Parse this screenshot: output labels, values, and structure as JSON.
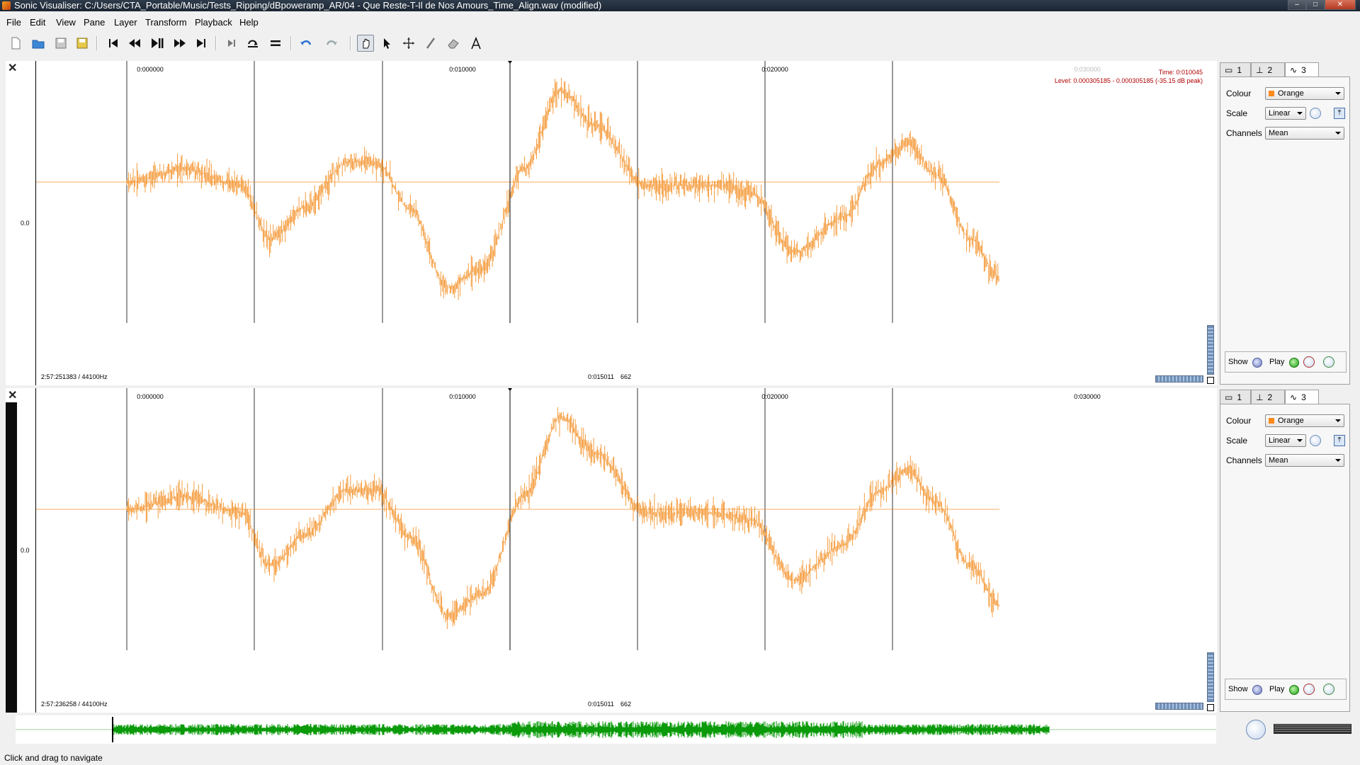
{
  "window": {
    "title": "Sonic Visualiser: C:/Users/CTA_Portable/Music/Tests_Ripping/dBpoweramp_AR/04 - Que Reste-T-Il de Nos Amours_Time_Align.wav (modified)",
    "minimize": "–",
    "maximize": "□",
    "close": "✕"
  },
  "menu": [
    "File",
    "Edit",
    "View",
    "Pane",
    "Layer",
    "Transform",
    "Playback",
    "Help"
  ],
  "toolbar": {
    "icons": [
      "new-document-icon",
      "open-folder-icon",
      "save-icon",
      "save-session-icon",
      "rewind-start-icon",
      "rewind-icon",
      "play-pause-icon",
      "fast-forward-icon",
      "fast-forward-end-icon",
      "constrain-playback-icon",
      "follow-playback-icon",
      "loop-icon",
      "undo-icon",
      "redo-icon",
      "navigate-icon",
      "select-icon",
      "move-icon",
      "draw-icon",
      "erase-icon",
      "measure-icon"
    ]
  },
  "colors": {
    "waveform": "#f4922a",
    "overview_waveform": "#0a9a0a",
    "cursor": "#000000"
  },
  "pane1": {
    "close": "✕",
    "time_ticks": [
      "0:000000",
      "0:010000",
      "0:020000",
      "0:030000"
    ],
    "y_label": "0.0",
    "info_time": "Time: 0:010045",
    "info_level": "Level: 0.000305185 - 0.000305185 (-35.15 dB peak)",
    "duration": "2:57:251383 / 44100Hz",
    "cursor_time": "0:015011",
    "cursor_frame": "662"
  },
  "pane2": {
    "close": "✕",
    "time_ticks": [
      "0:000000",
      "0:010000",
      "0:020000",
      "0:030000"
    ],
    "y_label": "0.0",
    "duration": "2:57:236258 / 44100Hz",
    "cursor_time": "0:015011",
    "cursor_frame": "662"
  },
  "properties": {
    "tabs": [
      "1",
      "2",
      "3"
    ],
    "colour_label": "Colour",
    "colour_value": "Orange",
    "scale_label": "Scale",
    "scale_value": "Linear",
    "channels_label": "Channels",
    "channels_value": "Mean",
    "show_label": "Show",
    "play_label": "Play"
  },
  "status": {
    "message": "Click and drag to navigate"
  }
}
